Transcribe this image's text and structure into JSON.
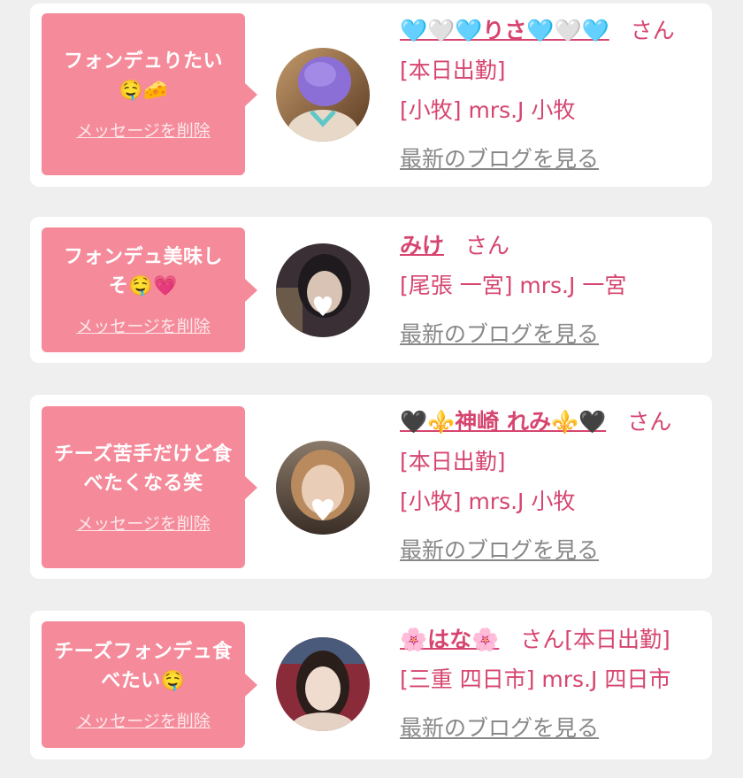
{
  "colors": {
    "accent": "#d6456f",
    "bubble": "#f58b9a",
    "background": "#efefef",
    "link_gray": "#888888"
  },
  "messages": [
    {
      "message": "フォンデュりたい🤤🧀",
      "delete_label": "メッセージを削除",
      "name": "🩵🤍🩵りさ🩵🤍🩵",
      "honorific": "さん",
      "status": "[本日出勤]",
      "store": "[小牧] mrs.J 小牧",
      "blog_label": "最新のブログを見る",
      "avatar_icon": "profile-photo-risa"
    },
    {
      "message": "フォンデュ美味しそ🤤💗",
      "delete_label": "メッセージを削除",
      "name": "みけ",
      "honorific": "さん",
      "status": "",
      "store": "[尾張 一宮] mrs.J 一宮",
      "blog_label": "最新のブログを見る",
      "avatar_icon": "profile-photo-mike"
    },
    {
      "message": "チーズ苦手だけど食べたくなる笑",
      "delete_label": "メッセージを削除",
      "name": "🖤⚜️神崎 れみ⚜️🖤",
      "honorific": "さん",
      "status": "[本日出勤]",
      "store": "[小牧] mrs.J 小牧",
      "blog_label": "最新のブログを見る",
      "avatar_icon": "profile-photo-remi"
    },
    {
      "message": "チーズフォンデュ食べたい🤤",
      "delete_label": "メッセージを削除",
      "name": "🌸はな🌸",
      "honorific": "さん",
      "status": "[本日出勤]",
      "store": "[三重 四日市] mrs.J 四日市",
      "blog_label": "最新のブログを見る",
      "avatar_icon": "profile-photo-hana"
    }
  ]
}
